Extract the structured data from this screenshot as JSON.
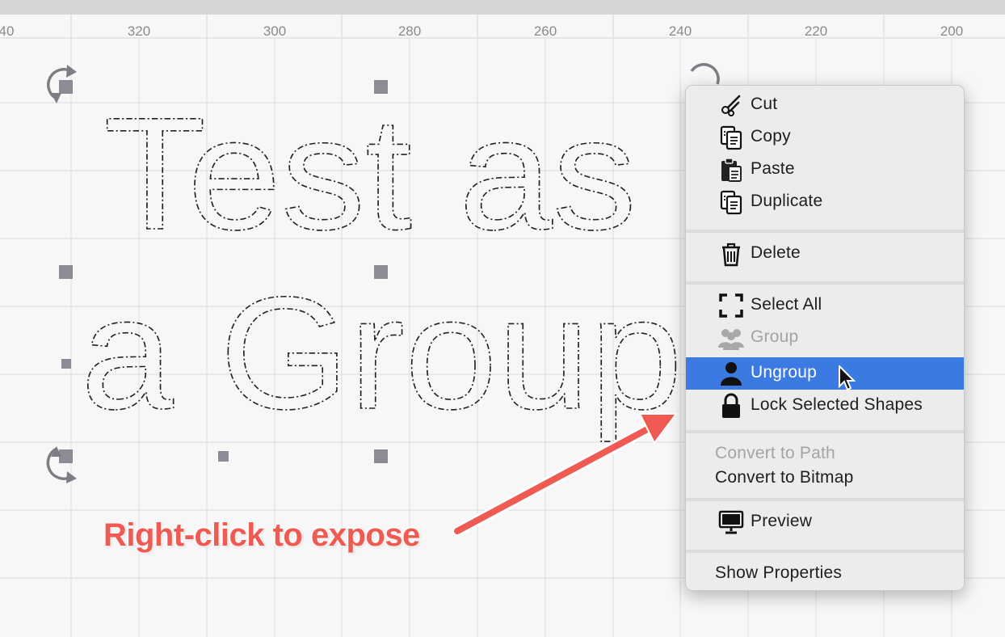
{
  "ruler": {
    "labels": [
      "40",
      "320",
      "300",
      "280",
      "260",
      "240",
      "220",
      "200"
    ]
  },
  "canvas": {
    "text_line_1": "Test as",
    "text_line_2": "a Group"
  },
  "context_menu": {
    "items": [
      {
        "label": "Cut",
        "icon": "scissors-icon",
        "enabled": true
      },
      {
        "label": "Copy",
        "icon": "copy-icon",
        "enabled": true
      },
      {
        "label": "Paste",
        "icon": "clipboard-icon",
        "enabled": true
      },
      {
        "label": "Duplicate",
        "icon": "duplicate-icon",
        "enabled": true
      },
      {
        "label": "Delete",
        "icon": "trash-icon",
        "enabled": true
      },
      {
        "label": "Select All",
        "icon": "select-all-icon",
        "enabled": true
      },
      {
        "label": "Group",
        "icon": "group-icon",
        "enabled": false
      },
      {
        "label": "Ungroup",
        "icon": "person-icon",
        "enabled": true,
        "highlighted": true
      },
      {
        "label": "Lock Selected Shapes",
        "icon": "lock-icon",
        "enabled": true
      },
      {
        "label": "Convert to Path",
        "enabled": false
      },
      {
        "label": "Convert to Bitmap",
        "enabled": true
      },
      {
        "label": "Preview",
        "icon": "monitor-icon",
        "enabled": true
      },
      {
        "label": "Show Properties",
        "enabled": true
      }
    ]
  },
  "annotation": {
    "text": "Right-click to expose"
  },
  "colors": {
    "highlight": "#3b7ae0",
    "annotation": "#ef5a52",
    "arrow": "#ef5a52"
  }
}
